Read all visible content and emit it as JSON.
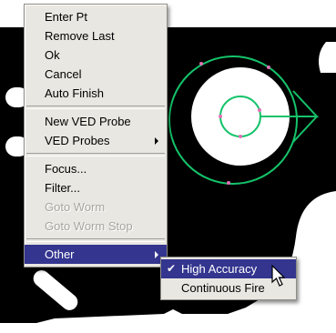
{
  "menu": {
    "items": [
      {
        "label": "Enter Pt"
      },
      {
        "label": "Remove Last"
      },
      {
        "label": "Ok"
      },
      {
        "label": "Cancel"
      },
      {
        "label": "Auto Finish"
      },
      {
        "label": "New VED Probe"
      },
      {
        "label": "VED Probes"
      },
      {
        "label": "Focus..."
      },
      {
        "label": "Filter..."
      },
      {
        "label": "Goto Worm"
      },
      {
        "label": "Goto Worm Stop"
      },
      {
        "label": "Other"
      }
    ]
  },
  "submenu": {
    "items": [
      {
        "label": "High Accuracy",
        "checked": true
      },
      {
        "label": "Continuous Fire"
      }
    ]
  },
  "icons": {
    "check": "checkmark-icon",
    "submenu_arrow": "submenu-arrow-icon",
    "cursor": "mouse-pointer-icon"
  },
  "colors": {
    "highlight": "#33358f",
    "menu_bg": "#e9e7e1",
    "overlay_green": "#15c36a",
    "marker_pink": "#e36fb6",
    "image_bg": "#000000"
  }
}
